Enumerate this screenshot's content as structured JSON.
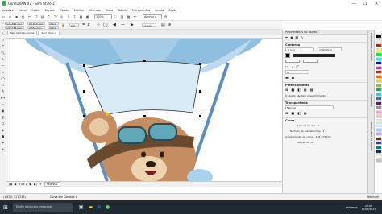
{
  "window": {
    "title": "CorelDRAW X7 - Sem título-1",
    "minimize": "—",
    "maximize": "❐",
    "close": "✕"
  },
  "menu": [
    "Arquivo",
    "Editar",
    "Exibir",
    "Layout",
    "Objeto",
    "Efeitos",
    "Bitmaps",
    "Texto",
    "Tabela",
    "Ferramentas",
    "Janela",
    "Ajuda"
  ],
  "toolbar": {
    "zoom": "100%",
    "snap": "Alinhar a"
  },
  "propbar": {
    "x": "135,887 mm",
    "y": "132,756 mm",
    "w": "64,828 mm",
    "h": "2,556 mm",
    "sx": "100,0",
    "sy": "100,0",
    "angle": "0,0",
    "outline": ".2 mm"
  },
  "tabs": [
    "Tela de boas-vindas",
    "Sem título-1"
  ],
  "pagenav": {
    "counter": "1 de 1",
    "page": "Página 1"
  },
  "docker": {
    "title": "Propriedades do objeto",
    "contorno": {
      "label": "Contorno",
      "width": ".2 mm",
      "unit": "milímetros"
    },
    "preenchimento": {
      "label": "Preenchimento",
      "message": "O objeto não tem preenchimento."
    },
    "transparencia": {
      "label": "Transparência",
      "mode": "Normal"
    },
    "curva": {
      "label": "Curva",
      "nodes_label": "Número de nós:",
      "nodes_value": "4",
      "sub_label": "Número de subcaminhos:",
      "sub_value": "1",
      "length_label": "Comprimento da curva:",
      "length_value": "158,173 mm",
      "pos_label": "Posição do nó"
    }
  },
  "side_tabs": [
    "Propriedades do objeto",
    "Sugestões",
    "Gerenciador de objetos"
  ],
  "status": {
    "coords": "(1,674; 111,248)",
    "info": "Curva em Camada 1",
    "fill": "Nenhum"
  },
  "taskbar": {
    "search": "Digite aqui para pesquisar",
    "time": "23:04",
    "date": "17/07/2017",
    "lang": "POR PTB2"
  },
  "colors": {
    "accent": "#2b78c2",
    "sky": "#a9cde6",
    "bear": "#c48e62",
    "balloon": "#78b0d6",
    "goggle": "#5fa8b8"
  },
  "palette": [
    "#ffffff",
    "#000000",
    "#e6e6e6",
    "#ff0000",
    "#ffff00",
    "#00ff00",
    "#00ffff",
    "#0000ff",
    "#ff00ff",
    "#993300",
    "#ff6600",
    "#ffcc00",
    "#99cc00",
    "#339966",
    "#33cccc",
    "#3366ff",
    "#800080",
    "#969696",
    "#ff99cc",
    "#ffcc99",
    "#ccffcc",
    "#ccffff",
    "#99ccff",
    "#cc99ff",
    "#663300",
    "#333399",
    "#008080",
    "#003366",
    "#ffffcc",
    "#c0c0c0"
  ]
}
